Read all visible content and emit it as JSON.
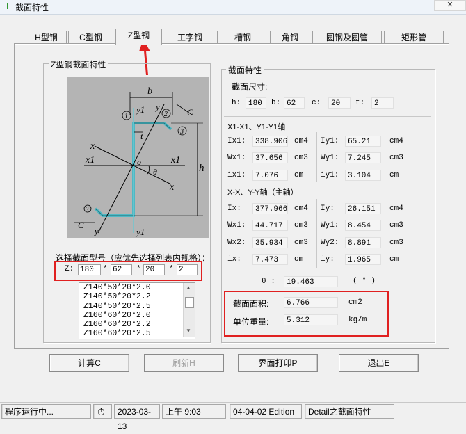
{
  "window": {
    "title": "截面特性",
    "close_label": "✕"
  },
  "tabs": [
    "H型钢",
    "C型钢",
    "Z型钢",
    "工字钢",
    "槽钢",
    "角钢",
    "圆钢及圆管",
    "矩形管"
  ],
  "left_group": {
    "title": "Z型钢截面特性"
  },
  "diagram": {
    "b": "b",
    "y1_top": "y1",
    "y_top": "y",
    "c_top": "C",
    "n1": "1",
    "n2": "2",
    "n3": "3",
    "t": "t",
    "x_left": "x",
    "x1_left": "x1",
    "o": "o",
    "x1_right": "x1",
    "theta": "θ",
    "x_right": "x",
    "h": "h",
    "n3b": "3",
    "c_bottom": "C",
    "y_bottom": "y",
    "y1_bottom": "y1"
  },
  "select": {
    "label": "选择截面型号（应优先选择列表内规格）：",
    "z_label": "Z:",
    "h": "180",
    "b": "62",
    "c": "20",
    "t": "2",
    "sep": "*",
    "list": [
      "Z140*50*20*2.0",
      "Z140*50*20*2.2",
      "Z140*50*20*2.5",
      "Z160*60*20*2.0",
      "Z160*60*20*2.2",
      "Z160*60*20*2.5"
    ]
  },
  "right_group": {
    "title": "截面特性",
    "size_label": "截面尺寸:",
    "dims": [
      {
        "label": "h:",
        "value": "180"
      },
      {
        "label": "b:",
        "value": "62"
      },
      {
        "label": "c:",
        "value": "20"
      },
      {
        "label": "t:",
        "value": "2"
      }
    ],
    "axis1_title": "X1-X1、Y1-Y1轴",
    "axis1_left": [
      {
        "label": "Ix1:",
        "value": "338.906",
        "unit": "cm4"
      },
      {
        "label": "Wx1:",
        "value": "37.656",
        "unit": "cm3"
      },
      {
        "label": "ix1:",
        "value": "7.076",
        "unit": "cm"
      }
    ],
    "axis1_right": [
      {
        "label": "Iy1:",
        "value": "65.21",
        "unit": "cm4"
      },
      {
        "label": "Wy1:",
        "value": "7.245",
        "unit": "cm3"
      },
      {
        "label": "iy1:",
        "value": "3.104",
        "unit": "cm"
      }
    ],
    "axis2_title": "X-X、Y-Y轴（主轴）",
    "axis2_left": [
      {
        "label": "Ix:",
        "value": "377.966",
        "unit": "cm4"
      },
      {
        "label": "Wx1:",
        "value": "44.717",
        "unit": "cm3"
      },
      {
        "label": "Wx2:",
        "value": "35.934",
        "unit": "cm3"
      },
      {
        "label": "ix:",
        "value": "7.473",
        "unit": "cm"
      }
    ],
    "axis2_right": [
      {
        "label": "Iy:",
        "value": "26.151",
        "unit": "cm4"
      },
      {
        "label": "Wy1:",
        "value": "8.454",
        "unit": "cm3"
      },
      {
        "label": "Wy2:",
        "value": "8.891",
        "unit": "cm3"
      },
      {
        "label": "iy:",
        "value": "1.965",
        "unit": "cm"
      }
    ],
    "theta_label": "θ :",
    "theta_value": "19.463",
    "theta_unit": "( ° )",
    "area_label": "截面面积:",
    "area_value": "6.766",
    "area_unit": "cm2",
    "weight_label": "单位重量:",
    "weight_value": "5.312",
    "weight_unit": "kg/m"
  },
  "buttons": {
    "calc": "计算C",
    "refresh": "刷新H",
    "print": "界面打印P",
    "exit": "退出E"
  },
  "status": {
    "state": "程序运行中...",
    "date": "2023-03-13",
    "time": "上午 9:03",
    "edition": "04-04-02 Edition",
    "detail": "Detail之截面特性"
  },
  "colors": {
    "highlight": "#e02020",
    "profile": "#4fb8c4",
    "diagram_bg": "#b4b4b4"
  }
}
